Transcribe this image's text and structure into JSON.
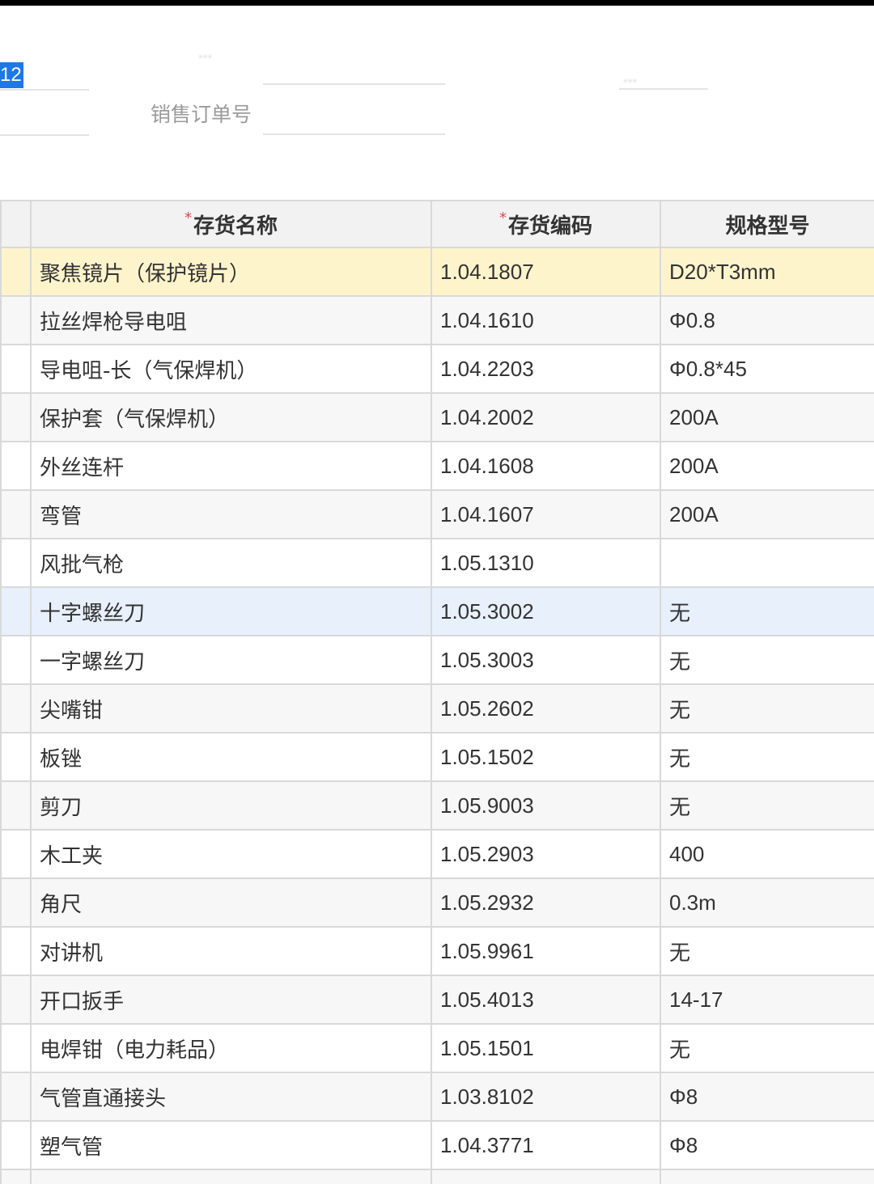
{
  "form": {
    "selected_value": "12",
    "sales_order_label": "销售订单号",
    "blurred_label": "...",
    "blurred_label_right": "..."
  },
  "table": {
    "headers": [
      {
        "label": "",
        "required": false
      },
      {
        "label": "存货名称",
        "required": true
      },
      {
        "label": "存货编码",
        "required": true
      },
      {
        "label": "规格型号",
        "required": false
      }
    ],
    "required_mark": "*",
    "rows": [
      {
        "name": "聚焦镜片（保护镜片）",
        "code": "1.04.1807",
        "spec": "D20*T3mm"
      },
      {
        "name": "拉丝焊枪导电咀",
        "code": "1.04.1610",
        "spec": "Φ0.8"
      },
      {
        "name": "导电咀-长（气保焊机）",
        "code": "1.04.2203",
        "spec": "Φ0.8*45"
      },
      {
        "name": "保护套（气保焊机）",
        "code": "1.04.2002",
        "spec": "200A"
      },
      {
        "name": "外丝连杆",
        "code": "1.04.1608",
        "spec": "200A"
      },
      {
        "name": "弯管",
        "code": "1.04.1607",
        "spec": "200A"
      },
      {
        "name": "风批气枪",
        "code": "1.05.1310",
        "spec": ""
      },
      {
        "name": "十字螺丝刀",
        "code": "1.05.3002",
        "spec": "无"
      },
      {
        "name": "一字螺丝刀",
        "code": "1.05.3003",
        "spec": "无"
      },
      {
        "name": "尖嘴钳",
        "code": "1.05.2602",
        "spec": "无"
      },
      {
        "name": "板锉",
        "code": "1.05.1502",
        "spec": "无"
      },
      {
        "name": "剪刀",
        "code": "1.05.9003",
        "spec": "无"
      },
      {
        "name": "木工夹",
        "code": "1.05.2903",
        "spec": "400"
      },
      {
        "name": "角尺",
        "code": "1.05.2932",
        "spec": "0.3m"
      },
      {
        "name": "对讲机",
        "code": "1.05.9961",
        "spec": "无"
      },
      {
        "name": "开口扳手",
        "code": "1.05.4013",
        "spec": "14-17"
      },
      {
        "name": "电焊钳（电力耗品）",
        "code": "1.05.1501",
        "spec": "无"
      },
      {
        "name": "气管直通接头",
        "code": "1.03.8102",
        "spec": "Φ8"
      },
      {
        "name": "塑气管",
        "code": "1.04.3771",
        "spec": "Φ8"
      },
      {
        "name": "",
        "code": "",
        "spec": ""
      }
    ]
  }
}
